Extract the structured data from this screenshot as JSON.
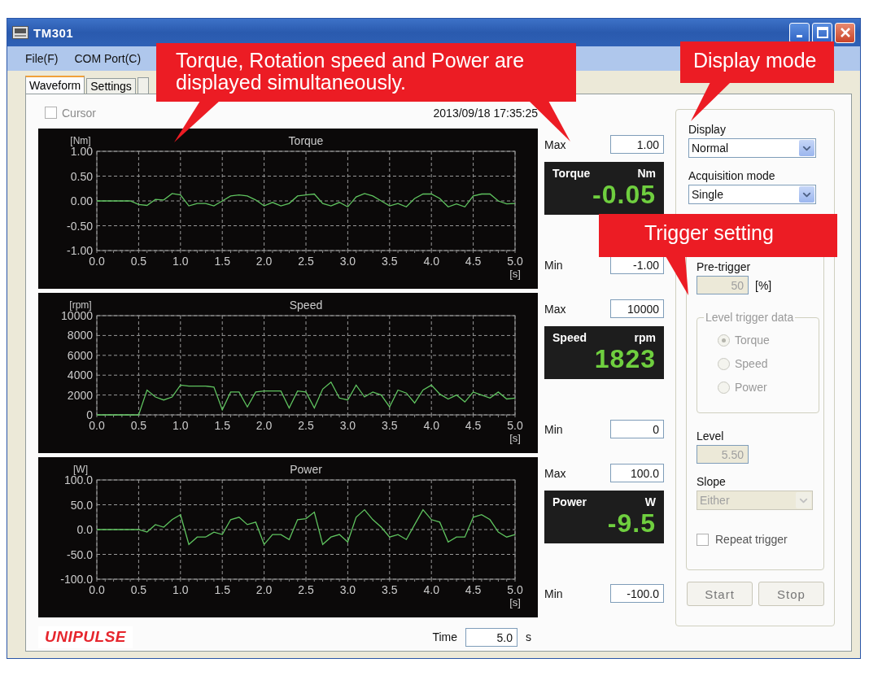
{
  "window": {
    "title": "TM301"
  },
  "menu": [
    "File(F)",
    "COM Port(C)"
  ],
  "tabs": [
    {
      "label": "Waveform",
      "selected": true
    },
    {
      "label": "Settings",
      "selected": false
    }
  ],
  "cursor": {
    "label": "Cursor",
    "checked": false
  },
  "timestamp": "2013/09/18 17:35:25",
  "channels": [
    {
      "name": "Torque",
      "unit": "Nm",
      "value": "-0.05",
      "max_label": "Max",
      "max": "1.00",
      "min_label": "Min",
      "min": "-1.00",
      "chart_data": {
        "type": "line",
        "title": "Torque",
        "xlabel": "[s]",
        "ylabel": "[Nm]",
        "xlim": [
          0,
          5
        ],
        "ylim": [
          -1,
          1
        ],
        "xticks": [
          {
            "value": 0,
            "label": "0.0"
          },
          {
            "value": 0.5,
            "label": "0.5"
          },
          {
            "value": 1,
            "label": "1.0"
          },
          {
            "value": 1.5,
            "label": "1.5"
          },
          {
            "value": 2,
            "label": "2.0"
          },
          {
            "value": 2.5,
            "label": "2.5"
          },
          {
            "value": 3,
            "label": "3.0"
          },
          {
            "value": 3.5,
            "label": "3.5"
          },
          {
            "value": 4,
            "label": "4.0"
          },
          {
            "value": 4.5,
            "label": "4.5"
          },
          {
            "value": 5,
            "label": "5.0"
          }
        ],
        "yticks": [
          {
            "value": 1,
            "label": "1.00"
          },
          {
            "value": 0.5,
            "label": "0.50"
          },
          {
            "value": 0,
            "label": "0.00"
          },
          {
            "value": -0.5,
            "label": "-0.50"
          },
          {
            "value": -1,
            "label": "-1.00"
          }
        ],
        "x": [
          0,
          0.1,
          0.2,
          0.3,
          0.4,
          0.5,
          0.6,
          0.7,
          0.8,
          0.9,
          1,
          1.1,
          1.2,
          1.3,
          1.4,
          1.5,
          1.6,
          1.7,
          1.8,
          1.9,
          2,
          2.1,
          2.2,
          2.3,
          2.4,
          2.5,
          2.6,
          2.7,
          2.8,
          2.9,
          3,
          3.1,
          3.2,
          3.3,
          3.4,
          3.5,
          3.6,
          3.7,
          3.8,
          3.9,
          4,
          4.1,
          4.2,
          4.3,
          4.4,
          4.5,
          4.6,
          4.7,
          4.8,
          4.9,
          5
        ],
        "grid": true,
        "series": [
          {
            "color": "#5fc35f",
            "values": [
              0,
              0,
              0,
              0,
              0,
              -0.07,
              -0.09,
              0.03,
              0.02,
              0.15,
              0.12,
              -0.1,
              -0.05,
              -0.05,
              -0.1,
              0,
              0.1,
              0.12,
              0.1,
              0.02,
              -0.1,
              -0.03,
              -0.1,
              -0.05,
              0.1,
              0.12,
              0.14,
              -0.05,
              -0.1,
              -0.03,
              -0.12,
              0.08,
              0.15,
              0.1,
              0,
              -0.1,
              -0.05,
              -0.12,
              0.05,
              0.14,
              0.14,
              0.05,
              -0.12,
              -0.06,
              -0.12,
              0.1,
              0.14,
              0.14,
              0,
              -0.06,
              -0.05
            ]
          }
        ]
      }
    },
    {
      "name": "Speed",
      "unit": "rpm",
      "value": "1823",
      "max_label": "Max",
      "max": "10000",
      "min_label": "Min",
      "min": "0",
      "chart_data": {
        "type": "line",
        "title": "Speed",
        "xlabel": "[s]",
        "ylabel": "[rpm]",
        "xlim": [
          0,
          5
        ],
        "ylim": [
          0,
          10000
        ],
        "xticks": [
          {
            "value": 0,
            "label": "0.0"
          },
          {
            "value": 0.5,
            "label": "0.5"
          },
          {
            "value": 1,
            "label": "1.0"
          },
          {
            "value": 1.5,
            "label": "1.5"
          },
          {
            "value": 2,
            "label": "2.0"
          },
          {
            "value": 2.5,
            "label": "2.5"
          },
          {
            "value": 3,
            "label": "3.0"
          },
          {
            "value": 3.5,
            "label": "3.5"
          },
          {
            "value": 4,
            "label": "4.0"
          },
          {
            "value": 4.5,
            "label": "4.5"
          },
          {
            "value": 5,
            "label": "5.0"
          }
        ],
        "yticks": [
          10000,
          8000,
          6000,
          4000,
          2000,
          0
        ],
        "x": [
          0,
          0.1,
          0.2,
          0.3,
          0.4,
          0.5,
          0.6,
          0.7,
          0.8,
          0.9,
          1,
          1.1,
          1.2,
          1.3,
          1.4,
          1.5,
          1.6,
          1.7,
          1.8,
          1.9,
          2,
          2.1,
          2.2,
          2.3,
          2.4,
          2.5,
          2.6,
          2.7,
          2.8,
          2.9,
          3,
          3.1,
          3.2,
          3.3,
          3.4,
          3.5,
          3.6,
          3.7,
          3.8,
          3.9,
          4,
          4.1,
          4.2,
          4.3,
          4.4,
          4.5,
          4.6,
          4.7,
          4.8,
          4.9,
          5
        ],
        "grid": true,
        "series": [
          {
            "color": "#5fc35f",
            "values": [
              0,
              0,
              0,
              0,
              0,
              0,
              2500,
              1800,
              1500,
              1800,
              3000,
              2900,
              2900,
              2900,
              2800,
              500,
              2300,
              2300,
              800,
              2300,
              2400,
              2400,
              2400,
              700,
              2400,
              2300,
              700,
              2600,
              3300,
              1700,
              1500,
              3000,
              1800,
              2300,
              2000,
              800,
              2500,
              2200,
              1200,
              2500,
              3000,
              2100,
              1600,
              2000,
              1300,
              2300,
              2000,
              1700,
              2300,
              1600,
              1700
            ]
          }
        ]
      }
    },
    {
      "name": "Power",
      "unit": "W",
      "value": "-9.5",
      "max_label": "Max",
      "max": "100.0",
      "min_label": "Min",
      "min": "-100.0",
      "chart_data": {
        "type": "line",
        "title": "Power",
        "xlabel": "[s]",
        "ylabel": "[W]",
        "xlim": [
          0,
          5
        ],
        "ylim": [
          -100,
          100
        ],
        "xticks": [
          {
            "value": 0,
            "label": "0.0"
          },
          {
            "value": 0.5,
            "label": "0.5"
          },
          {
            "value": 1,
            "label": "1.0"
          },
          {
            "value": 1.5,
            "label": "1.5"
          },
          {
            "value": 2,
            "label": "2.0"
          },
          {
            "value": 2.5,
            "label": "2.5"
          },
          {
            "value": 3,
            "label": "3.0"
          },
          {
            "value": 3.5,
            "label": "3.5"
          },
          {
            "value": 4,
            "label": "4.0"
          },
          {
            "value": 4.5,
            "label": "4.5"
          },
          {
            "value": 5,
            "label": "5.0"
          }
        ],
        "yticks": [
          {
            "value": 100,
            "label": "100.0"
          },
          {
            "value": 50,
            "label": "50.0"
          },
          {
            "value": 0,
            "label": "0.0"
          },
          {
            "value": -50,
            "label": "-50.0"
          },
          {
            "value": -100,
            "label": "-100.0"
          }
        ],
        "x": [
          0,
          0.1,
          0.2,
          0.3,
          0.4,
          0.5,
          0.6,
          0.7,
          0.8,
          0.9,
          1,
          1.1,
          1.2,
          1.3,
          1.4,
          1.5,
          1.6,
          1.7,
          1.8,
          1.9,
          2,
          2.1,
          2.2,
          2.3,
          2.4,
          2.5,
          2.6,
          2.7,
          2.8,
          2.9,
          3,
          3.1,
          3.2,
          3.3,
          3.4,
          3.5,
          3.6,
          3.7,
          3.8,
          3.9,
          4,
          4.1,
          4.2,
          4.3,
          4.4,
          4.5,
          4.6,
          4.7,
          4.8,
          4.9,
          5
        ],
        "grid": true,
        "series": [
          {
            "color": "#5fc35f",
            "values": [
              0,
              0,
              0,
              0,
              0,
              0,
              -5,
              10,
              5,
              20,
              30,
              -30,
              -15,
              -15,
              -5,
              -10,
              20,
              25,
              10,
              15,
              -30,
              -10,
              -10,
              -20,
              20,
              22,
              35,
              -30,
              -15,
              -10,
              -25,
              25,
              40,
              20,
              5,
              -15,
              -10,
              -20,
              10,
              40,
              20,
              15,
              -25,
              -15,
              -15,
              25,
              30,
              20,
              -5,
              -15,
              -10
            ]
          }
        ]
      }
    }
  ],
  "logo": "UNIPULSE",
  "time": {
    "label": "Time",
    "value": "5.0",
    "unit": "s"
  },
  "controls": {
    "display": {
      "label": "Display",
      "value": "Normal",
      "disabled": false
    },
    "acquisition": {
      "label": "Acquisition mode",
      "value": "Single",
      "disabled": false
    },
    "pretrigger": {
      "label": "Pre-trigger",
      "value": "50",
      "unit": "[%]",
      "disabled": true
    },
    "level_trigger": {
      "title": "Level trigger data",
      "disabled": true,
      "options": [
        {
          "label": "Torque",
          "selected": true
        },
        {
          "label": "Speed",
          "selected": false
        },
        {
          "label": "Power",
          "selected": false
        }
      ]
    },
    "level": {
      "label": "Level",
      "value": "5.50",
      "disabled": true
    },
    "slope": {
      "label": "Slope",
      "value": "Either",
      "disabled": true
    },
    "repeat": {
      "label": "Repeat trigger",
      "checked": false
    },
    "buttons": [
      "Start",
      "Stop"
    ]
  },
  "callouts": [
    {
      "text": "Torque, Rotation speed and Power are displayed simultaneously."
    },
    {
      "text": "Display mode"
    },
    {
      "text": "Trigger setting"
    }
  ]
}
